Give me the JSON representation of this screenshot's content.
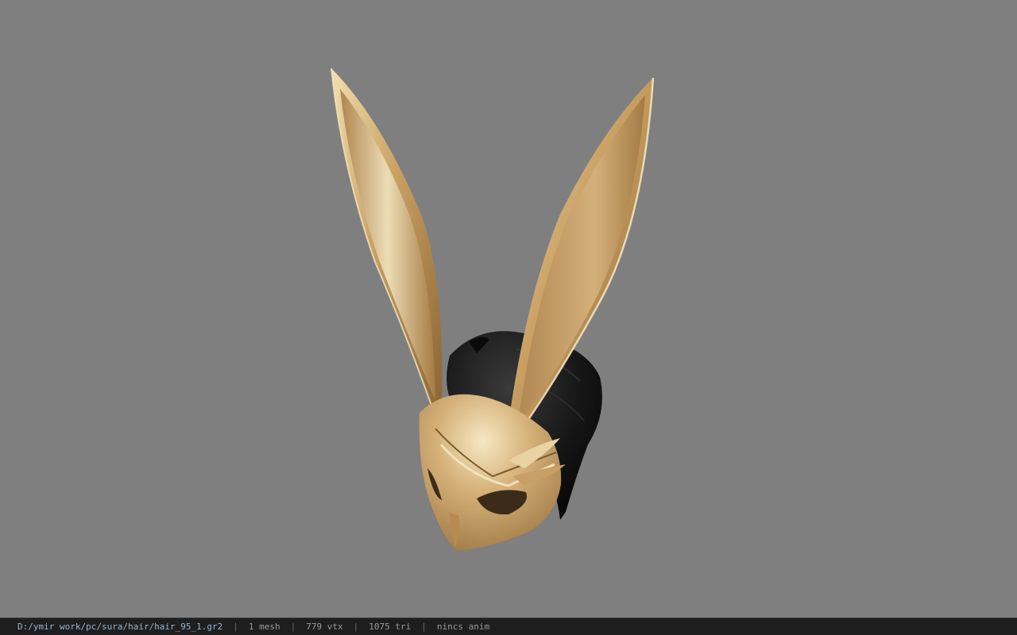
{
  "viewport": {
    "background_color": "#7f7f7f",
    "model_name": "gold-rabbit-ear-mask-with-black-hair"
  },
  "status_bar": {
    "file_path": "D:/ymir work/pc/sura/hair/hair_95_1.gr2",
    "mesh_count": "1 mesh",
    "vertex_count": "779 vtx",
    "triangle_count": "1075 tri",
    "anim_status": "nincs anim",
    "separator": "|",
    "path_color": "#8fb8d8"
  }
}
